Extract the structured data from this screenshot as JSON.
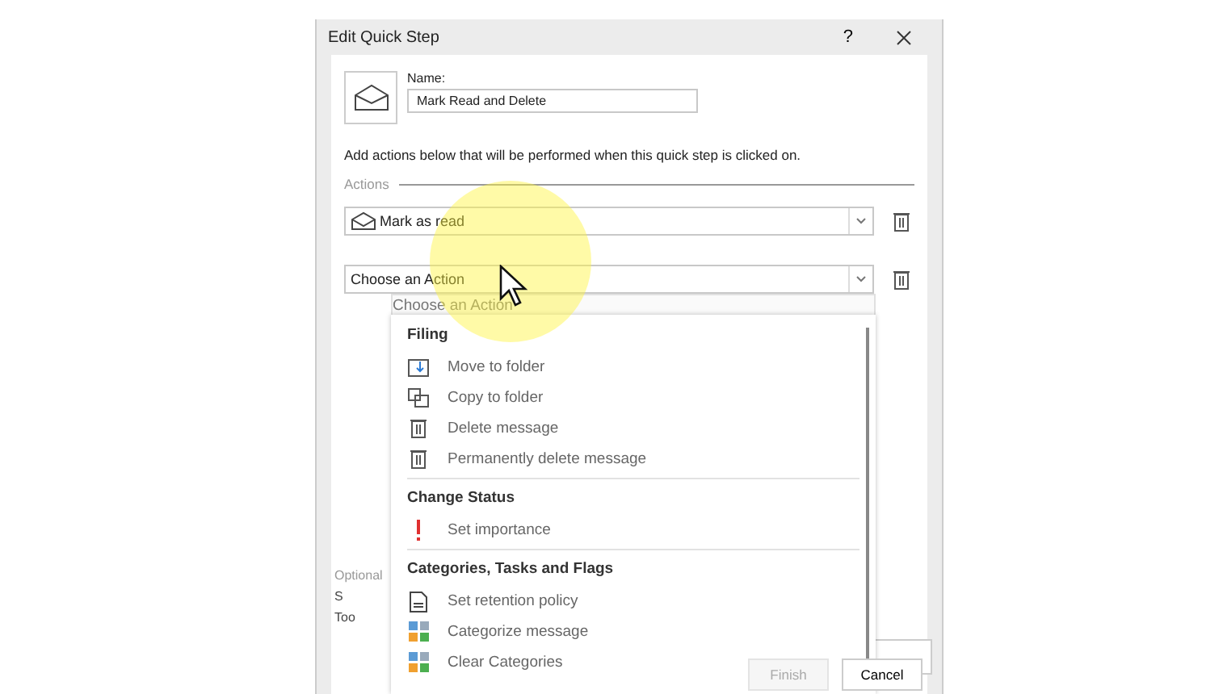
{
  "dialog": {
    "title": "Edit Quick Step",
    "help": "?",
    "name_label": "Name:",
    "name_value": "Mark Read and Delete",
    "instructions": "Add actions below that will be performed when this quick step is clicked on.",
    "actions_label": "Actions",
    "actions": [
      {
        "label": "Mark as read",
        "kind": "mark-read"
      },
      {
        "label": "Choose an Action",
        "kind": "empty"
      }
    ],
    "optional_label": "Optional",
    "shortcut_label": "S",
    "tooltip_label": "Too",
    "buttons": [
      {
        "label": "Finish",
        "disabled": true
      },
      {
        "label": "Cancel",
        "disabled": false
      }
    ]
  },
  "dropdown": {
    "header": "Choose an Action",
    "groups": [
      {
        "title": "Filing",
        "items": [
          {
            "label": "Move to folder",
            "kind": "move"
          },
          {
            "label": "Copy to folder",
            "kind": "copy"
          },
          {
            "label": "Delete message",
            "kind": "delete"
          },
          {
            "label": "Permanently delete message",
            "kind": "delete"
          }
        ]
      },
      {
        "title": "Change Status",
        "items": [
          {
            "label": "Set importance",
            "kind": "importance"
          }
        ]
      },
      {
        "title": "Categories, Tasks and Flags",
        "items": [
          {
            "label": "Set retention policy",
            "kind": "retention"
          },
          {
            "label": "Categorize message",
            "kind": "categorize"
          },
          {
            "label": "Clear Categories",
            "kind": "categorize"
          }
        ]
      }
    ]
  }
}
